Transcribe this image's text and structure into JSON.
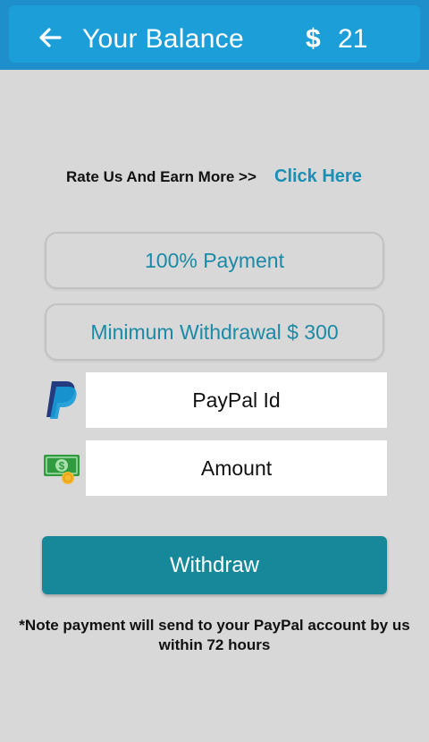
{
  "header": {
    "title": "Your Balance",
    "currency_symbol": "$",
    "balance": "21",
    "back_icon": "arrow-left-icon"
  },
  "rate": {
    "text": "Rate Us And Earn More >>",
    "link": "Click Here"
  },
  "info": {
    "payment": "100% Payment",
    "minimum": "Minimum Withdrawal $ 300"
  },
  "form": {
    "paypal_placeholder": "PayPal Id",
    "paypal_icon": "paypal-icon",
    "amount_placeholder": "Amount",
    "amount_icon": "money-icon"
  },
  "withdraw_button": "Withdraw",
  "note": "*Note payment will send to your PayPal account by us within 72 hours",
  "colors": {
    "header": "#1c9fd8",
    "accent": "#1a8aa6",
    "button": "#16889a",
    "background": "#d8d8d8"
  }
}
